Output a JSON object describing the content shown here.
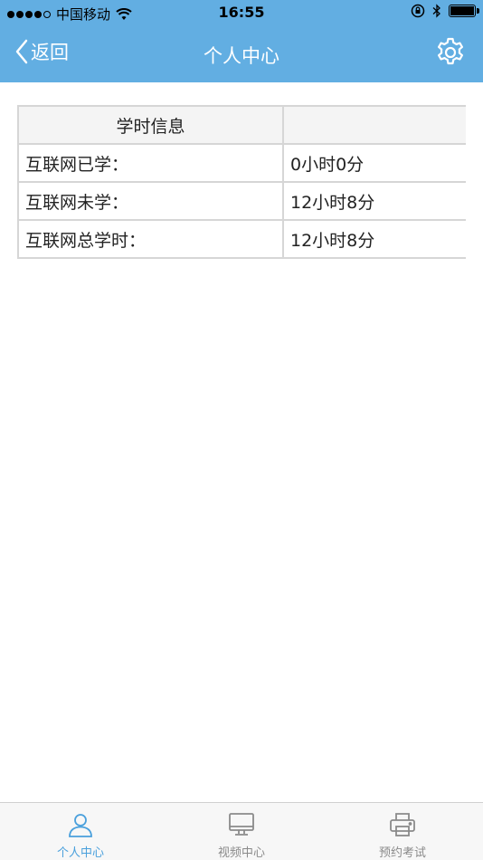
{
  "status_bar": {
    "carrier": "中国移动",
    "time": "16:55"
  },
  "nav": {
    "back_label": "返回",
    "title": "个人中心"
  },
  "table": {
    "header": [
      "学时信息",
      ""
    ],
    "rows": [
      {
        "label": "互联网已学：",
        "value": "0小时0分"
      },
      {
        "label": "互联网未学：",
        "value": "12小时8分"
      },
      {
        "label": "互联网总学时：",
        "value": "12小时8分"
      }
    ]
  },
  "tabs": [
    {
      "label": "个人中心",
      "icon": "person-icon",
      "active": true
    },
    {
      "label": "视频中心",
      "icon": "monitor-icon",
      "active": false
    },
    {
      "label": "预约考试",
      "icon": "printer-icon",
      "active": false
    }
  ],
  "colors": {
    "header_bg": "#62aee2",
    "tab_active": "#4aa0dc",
    "tab_inactive": "#8a8a8a"
  }
}
